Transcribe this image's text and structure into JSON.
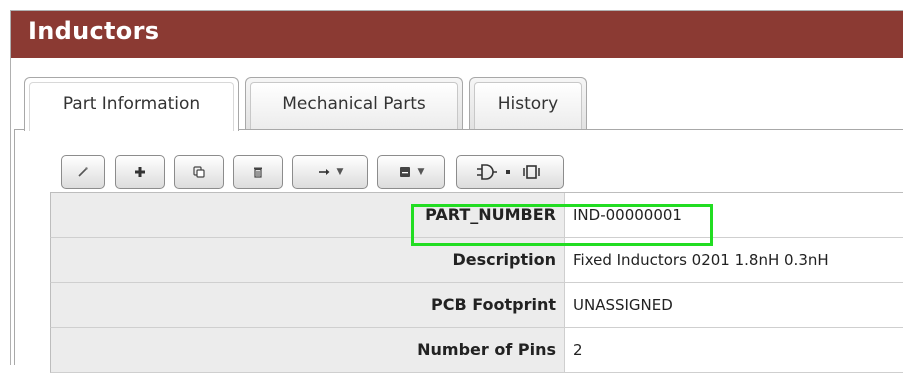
{
  "header": {
    "title": "Inductors"
  },
  "tabs": [
    {
      "label": "Part Information",
      "active": true
    },
    {
      "label": "Mechanical Parts",
      "active": false
    },
    {
      "label": "History",
      "active": false
    }
  ],
  "toolbar": {
    "buttons": [
      {
        "name": "edit-button",
        "icon": "pencil-icon"
      },
      {
        "name": "add-button",
        "icon": "plus-icon"
      },
      {
        "name": "copy-button",
        "icon": "copy-icon"
      },
      {
        "name": "delete-button",
        "icon": "trash-icon"
      },
      {
        "name": "move-dropdown-button",
        "icon": "arrow-right-icon"
      },
      {
        "name": "save-dropdown-button",
        "icon": "save-icon"
      },
      {
        "name": "symbol-footprint-button",
        "icon": "symbol-footprint-icon"
      }
    ]
  },
  "fields": [
    {
      "label": "PART_NUMBER",
      "value": "IND-00000001"
    },
    {
      "label": "Description",
      "value": "Fixed Inductors 0201 1.8nH 0.3nH"
    },
    {
      "label": "PCB Footprint",
      "value": "UNASSIGNED"
    },
    {
      "label": "Number of Pins",
      "value": "2"
    }
  ],
  "colors": {
    "title_bar": "#8b3a33",
    "highlight": "#22dd22",
    "label_bg": "#ececec"
  }
}
